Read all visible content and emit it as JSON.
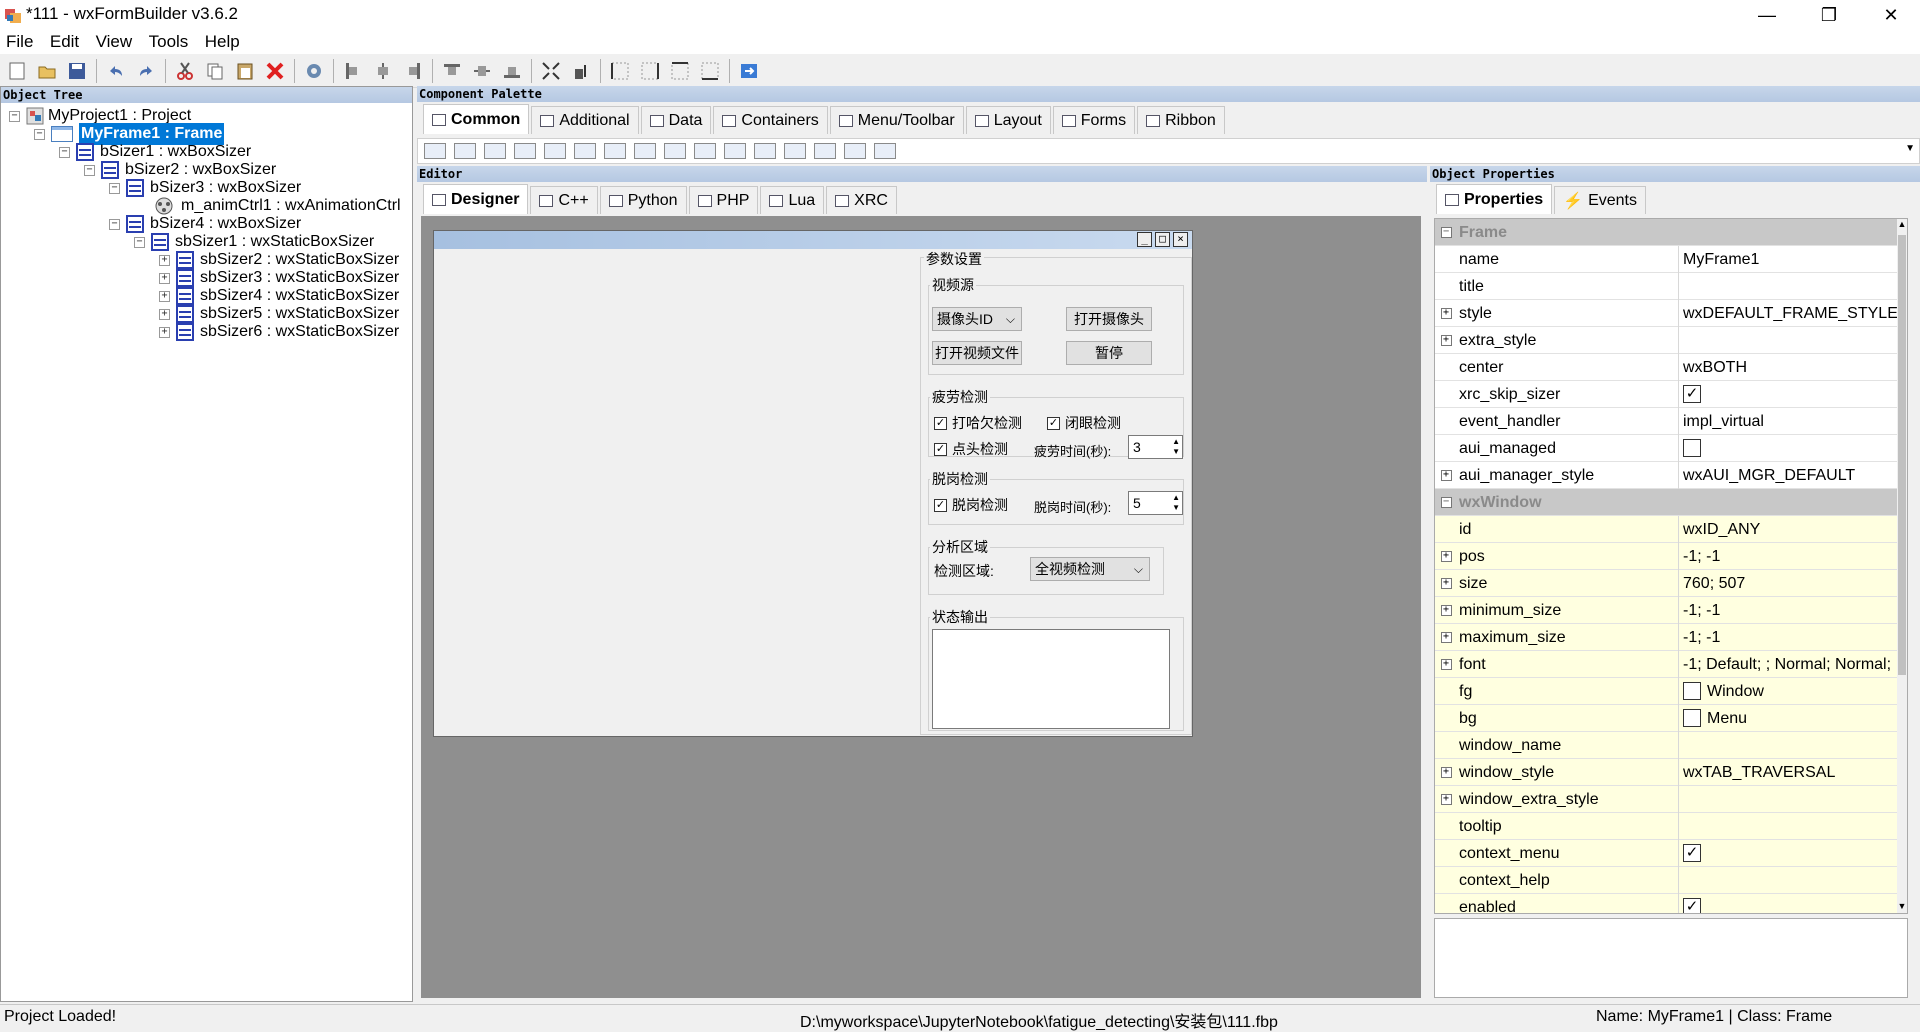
{
  "app": {
    "title": "*111 - wxFormBuilder v3.6.2"
  },
  "window_controls": {
    "minimize": "—",
    "maximize": "❐",
    "close": "✕"
  },
  "menu": [
    "File",
    "Edit",
    "View",
    "Tools",
    "Help"
  ],
  "toolbar": [
    "new-icon",
    "open-icon",
    "save-icon",
    "undo-icon",
    "redo-icon",
    "cut-icon",
    "copy-icon",
    "paste-icon",
    "delete-icon",
    "settings-icon",
    "align-left-icon",
    "align-center-icon",
    "align-right-icon",
    "align-top-icon",
    "align-middle-icon",
    "align-bottom-icon",
    "expand-icon",
    "stretch-icon",
    "border-left-icon",
    "border-right-icon",
    "border-top-icon",
    "border-bottom-icon",
    "generate-code-icon"
  ],
  "object_tree": {
    "title": "Object Tree",
    "nodes": [
      {
        "label": "MyProject1 : Project",
        "expand": "−"
      },
      {
        "label": "MyFrame1 : Frame",
        "expand": "−"
      },
      {
        "label": "bSizer1 : wxBoxSizer",
        "expand": "−"
      },
      {
        "label": "bSizer2 : wxBoxSizer",
        "expand": "−"
      },
      {
        "label": "bSizer3 : wxBoxSizer",
        "expand": "−"
      },
      {
        "label": "m_animCtrl1 : wxAnimationCtrl",
        "expand": ""
      },
      {
        "label": "bSizer4 : wxBoxSizer",
        "expand": "−"
      },
      {
        "label": "sbSizer1 : wxStaticBoxSizer",
        "expand": "−"
      },
      {
        "label": "sbSizer2 : wxStaticBoxSizer",
        "expand": "+"
      },
      {
        "label": "sbSizer3 : wxStaticBoxSizer",
        "expand": "+"
      },
      {
        "label": "sbSizer4 : wxStaticBoxSizer",
        "expand": "+"
      },
      {
        "label": "sbSizer5 : wxStaticBoxSizer",
        "expand": "+"
      },
      {
        "label": "sbSizer6 : wxStaticBoxSizer",
        "expand": "+"
      }
    ]
  },
  "palette": {
    "title": "Component Palette",
    "tabs": [
      "Common",
      "Additional",
      "Data",
      "Containers",
      "Menu/Toolbar",
      "Layout",
      "Forms",
      "Ribbon"
    ],
    "dropdown": "▼"
  },
  "editor": {
    "title": "Editor",
    "tabs": [
      "Designer",
      "C++",
      "Python",
      "PHP",
      "Lua",
      "XRC"
    ],
    "frame_buttons": {
      "min": "_",
      "max": "□",
      "close": "×"
    },
    "form": {
      "params_title": "参数设置",
      "video_source": {
        "title": "视频源",
        "combo_value": "摄像头ID",
        "open_camera": "打开摄像头",
        "open_video": "打开视频文件",
        "pause": "暂停"
      },
      "fatigue": {
        "title": "疲劳检测",
        "yawn": "打哈欠检测",
        "eyes": "闭眼检测",
        "nod": "点头检测",
        "time_label": "疲劳时间(秒):",
        "time_value": "3"
      },
      "absence": {
        "title": "脱岗检测",
        "absence_check": "脱岗检测",
        "time_label": "脱岗时间(秒):",
        "time_value": "5"
      },
      "region": {
        "title": "分析区域",
        "label": "检测区域:",
        "combo_value": "全视频检测"
      },
      "status": {
        "title": "状态输出"
      },
      "check_mark": "✓"
    }
  },
  "properties": {
    "title": "Object Properties",
    "tabs": [
      "Properties",
      "Events"
    ],
    "rows": [
      {
        "type": "cat",
        "name": "Frame",
        "exp": "−"
      },
      {
        "name": "name",
        "value": "MyFrame1",
        "exp": ""
      },
      {
        "name": "title",
        "value": "",
        "exp": ""
      },
      {
        "name": "style",
        "value": "wxDEFAULT_FRAME_STYLE",
        "exp": "+"
      },
      {
        "name": "extra_style",
        "value": "",
        "exp": "+"
      },
      {
        "name": "center",
        "value": "wxBOTH",
        "exp": ""
      },
      {
        "name": "xrc_skip_sizer",
        "value": "",
        "check": "✓",
        "exp": ""
      },
      {
        "name": "event_handler",
        "value": "impl_virtual",
        "exp": ""
      },
      {
        "name": "aui_managed",
        "value": "",
        "check": "",
        "exp": ""
      },
      {
        "name": "aui_manager_style",
        "value": "wxAUI_MGR_DEFAULT",
        "exp": "+"
      },
      {
        "type": "cat",
        "name": "wxWindow",
        "exp": "−"
      },
      {
        "name": "id",
        "value": "wxID_ANY",
        "exp": "",
        "yellow": true
      },
      {
        "name": "pos",
        "value": "-1; -1",
        "exp": "+",
        "yellow": true
      },
      {
        "name": "size",
        "value": "760; 507",
        "exp": "+",
        "yellow": true
      },
      {
        "name": "minimum_size",
        "value": "-1; -1",
        "exp": "+",
        "yellow": true
      },
      {
        "name": "maximum_size",
        "value": "-1; -1",
        "exp": "+",
        "yellow": true
      },
      {
        "name": "font",
        "value": "-1; Default; ; Normal; Normal;",
        "exp": "+",
        "yellow": true
      },
      {
        "name": "fg",
        "value": "Window",
        "check": "",
        "exp": "",
        "yellow": true
      },
      {
        "name": "bg",
        "value": "Menu",
        "check": "",
        "exp": "",
        "yellow": true
      },
      {
        "name": "window_name",
        "value": "",
        "exp": "",
        "yellow": true
      },
      {
        "name": "window_style",
        "value": "wxTAB_TRAVERSAL",
        "exp": "+",
        "yellow": true
      },
      {
        "name": "window_extra_style",
        "value": "",
        "exp": "+",
        "yellow": true
      },
      {
        "name": "tooltip",
        "value": "",
        "exp": "",
        "yellow": true
      },
      {
        "name": "context_menu",
        "value": "",
        "check": "✓",
        "exp": "",
        "yellow": true
      },
      {
        "name": "context_help",
        "value": "",
        "exp": "",
        "yellow": true
      },
      {
        "name": "enabled",
        "value": "",
        "check": "✓",
        "exp": "",
        "yellow": true
      }
    ]
  },
  "status": {
    "left": "Project Loaded!",
    "path": "D:\\myworkspace\\JupyterNotebook\\fatigue_detecting\\安装包\\111.fbp",
    "right": "Name: MyFrame1 | Class: Frame"
  }
}
